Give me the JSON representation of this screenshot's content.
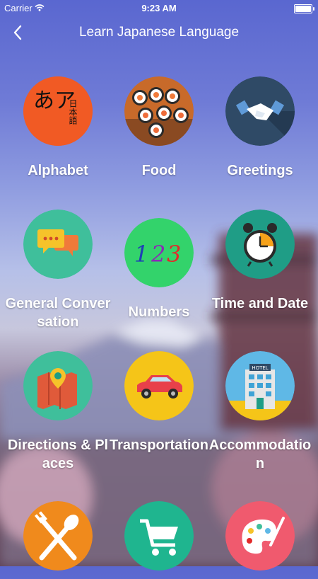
{
  "status_bar": {
    "carrier": "Carrier",
    "time": "9:23 AM"
  },
  "nav": {
    "title": "Learn Japanese Language",
    "back_icon": "chevron-left-icon"
  },
  "categories": [
    {
      "label": "Alphabet",
      "icon": "alphabet-kana-icon",
      "kana": "あア",
      "kanji": "日本語",
      "color": "#f15a24"
    },
    {
      "label": "Food",
      "icon": "sushi-icon"
    },
    {
      "label": "Greetings",
      "icon": "handshake-icon",
      "color": "#2f4a66"
    },
    {
      "label": "General Conversation",
      "icon": "chat-bubbles-icon",
      "color": "#3fbf9b"
    },
    {
      "label": "Numbers",
      "icon": "numbers-icon",
      "digits": [
        "1",
        "2",
        "3"
      ],
      "color": "#33d36b"
    },
    {
      "label": "Time and Date",
      "icon": "alarm-clock-icon",
      "color": "#1f9d86"
    },
    {
      "label": "Directions & Places",
      "icon": "map-pin-icon",
      "color": "#3fbf9b"
    },
    {
      "label": "Transportation",
      "icon": "car-icon",
      "color": "#f5c518"
    },
    {
      "label": "Accommodation",
      "icon": "hotel-icon",
      "hotel_sign": "HOTEL",
      "color": "#5fb8e6"
    },
    {
      "label": "",
      "icon": "fork-spoon-icon",
      "color": "#f08a1c"
    },
    {
      "label": "",
      "icon": "shopping-cart-icon",
      "color": "#1fb58f"
    },
    {
      "label": "",
      "icon": "palette-icon",
      "color": "#f05a6e"
    }
  ]
}
